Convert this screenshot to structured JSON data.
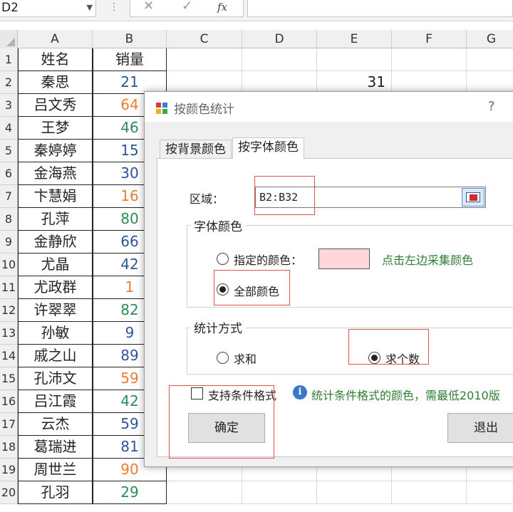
{
  "formula_bar": {
    "name_box": "D2",
    "dropdown_glyph": "▼",
    "separator": "⋮",
    "cancel_glyph": "✕",
    "confirm_glyph": "✓",
    "fx_label": "fx",
    "content": ""
  },
  "columns": [
    "A",
    "B",
    "C",
    "D",
    "E",
    "F",
    "G"
  ],
  "rows": [
    "1",
    "2",
    "3",
    "4",
    "5",
    "6",
    "7",
    "8",
    "9",
    "10",
    "11",
    "12",
    "13",
    "14",
    "15",
    "16",
    "17",
    "18",
    "19",
    "20"
  ],
  "header_cells": {
    "a1": "姓名",
    "b1": "销量"
  },
  "names": [
    "秦思",
    "吕文秀",
    "王梦",
    "秦婷婷",
    "金海燕",
    "卞慧娟",
    "孔萍",
    "金静欣",
    "尤晶",
    "尤政群",
    "许翠翠",
    "孙敏",
    "戚之山",
    "孔沛文",
    "吕江霞",
    "云杰",
    "葛瑞进",
    "周世兰",
    "孔羽"
  ],
  "sales": [
    {
      "value": "21",
      "color": "#2f5597"
    },
    {
      "value": "64",
      "color": "#ed7d31"
    },
    {
      "value": "46",
      "color": "#2e8b57"
    },
    {
      "value": "15",
      "color": "#2f5597"
    },
    {
      "value": "30",
      "color": "#2f5597"
    },
    {
      "value": "16",
      "color": "#ed7d31"
    },
    {
      "value": "80",
      "color": "#2e8b57"
    },
    {
      "value": "66",
      "color": "#2f5597"
    },
    {
      "value": "42",
      "color": "#2f5597"
    },
    {
      "value": "1",
      "color": "#ed7d31"
    },
    {
      "value": "82",
      "color": "#2e8b57"
    },
    {
      "value": "9",
      "color": "#2f5597"
    },
    {
      "value": "89",
      "color": "#2f5597"
    },
    {
      "value": "59",
      "color": "#ed7d31"
    },
    {
      "value": "42",
      "color": "#2e8b57"
    },
    {
      "value": "59",
      "color": "#2f5597"
    },
    {
      "value": "81",
      "color": "#2f5597"
    },
    {
      "value": "90",
      "color": "#ed7d31"
    },
    {
      "value": "29",
      "color": "#2e8b57"
    }
  ],
  "e2_value": "31",
  "dialog": {
    "title": "按颜色统计",
    "help": "?",
    "tabs": [
      "按背景颜色",
      "按字体颜色"
    ],
    "active_tab": 1,
    "range_label": "区域：",
    "range_value": "B2:B32",
    "font_color_group": "字体颜色",
    "specified_color_label": "指定的颜色：",
    "specified_color_swatch": "#ffd6d9",
    "pick_hint": "点击左边采集颜色",
    "all_colors_label": "全部颜色",
    "stat_group": "统计方式",
    "sum_label": "求和",
    "count_label": "求个数",
    "conditional_label": "支持条件格式",
    "info_glyph": "i",
    "info_text": "统计条件格式的颜色，需最低2010版",
    "ok_button": "确定",
    "exit_button": "退出"
  },
  "colors": {
    "annotation": "#e05050",
    "hint_green": "#2e7d32"
  }
}
